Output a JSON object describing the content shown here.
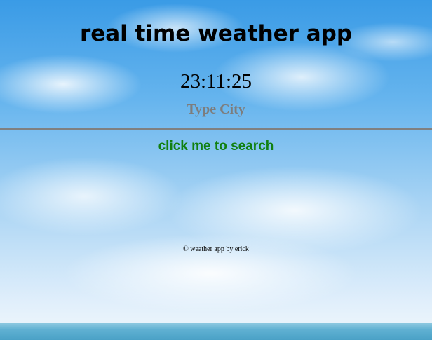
{
  "app": {
    "title": "real time weather app"
  },
  "clock": {
    "time": "23:11:25"
  },
  "search": {
    "placeholder": "Type City",
    "value": "",
    "button_label": "click me to search"
  },
  "footer": {
    "text": "© weather app by erick"
  },
  "colors": {
    "search_button": "#118011",
    "placeholder": "#7d7d7d",
    "divider": "#808080"
  }
}
